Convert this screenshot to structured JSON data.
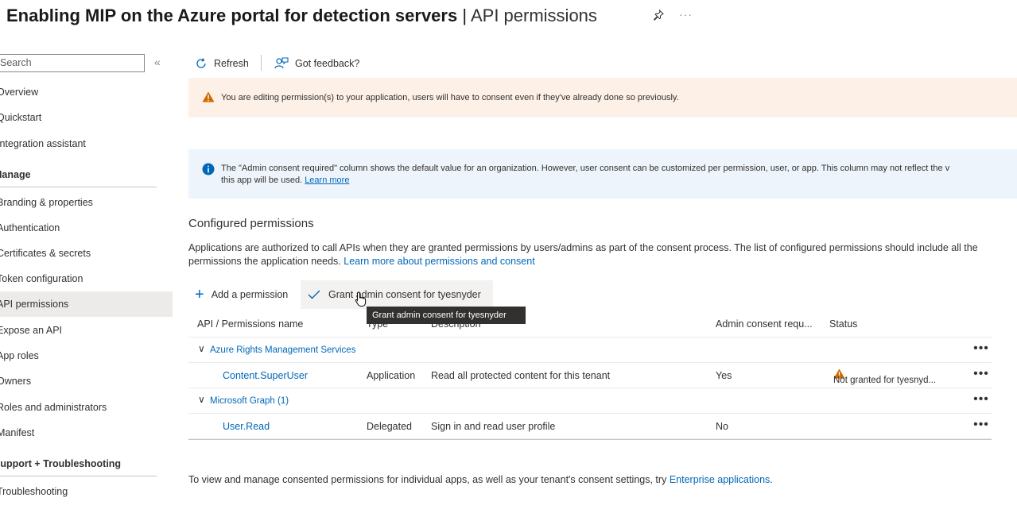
{
  "header": {
    "title": "Enabling MIP on the Azure portal for detection servers",
    "separator": "|",
    "subtitle": "API permissions",
    "more": "···"
  },
  "sidebar": {
    "search_value": "Search",
    "collapse": "«",
    "items": [
      {
        "label": "Overview"
      },
      {
        "label": "Quickstart"
      },
      {
        "label": "Integration assistant"
      }
    ],
    "manage_group": "Manage",
    "manage_items": [
      {
        "label": "Branding & properties"
      },
      {
        "label": "Authentication"
      },
      {
        "label": "Certificates & secrets"
      },
      {
        "label": "Token configuration"
      },
      {
        "label": "API permissions",
        "active": true
      },
      {
        "label": "Expose an API"
      },
      {
        "label": "App roles"
      },
      {
        "label": "Owners"
      },
      {
        "label": "Roles and administrators"
      },
      {
        "label": "Manifest"
      }
    ],
    "support_group": "Support + Troubleshooting",
    "support_items": [
      {
        "label": "Troubleshooting"
      }
    ]
  },
  "toolbar": {
    "refresh": "Refresh",
    "feedback": "Got feedback?"
  },
  "warning": {
    "text": "You are editing permission(s) to your application, users will have to consent even if they've already done so previously."
  },
  "info": {
    "line1": "The \"Admin consent required\" column shows the default value for an organization. However, user consent can be customized per permission, user, or app. This column may not reflect the v",
    "line2": "this app will be used.",
    "learn_more": "Learn more"
  },
  "configured": {
    "title": "Configured permissions",
    "desc": "Applications are authorized to call APIs when they are granted permissions by users/admins as part of the consent process. The list of configured permissions should include all the permissions the application needs.",
    "desc_link": "Learn more about permissions and consent"
  },
  "actions": {
    "add": "Add a permission",
    "grant": "Grant admin consent for tyesnyder",
    "tooltip": "Grant admin consent for tyesnyder"
  },
  "table": {
    "headers": {
      "name": "API / Permissions name",
      "type": "Type",
      "description": "Description",
      "admin": "Admin consent requ...",
      "status": "Status"
    },
    "groups": [
      {
        "name": "Azure Rights Management Services",
        "rows": [
          {
            "name": "Content.SuperUser",
            "type": "Application",
            "description": "Read all protected content for this tenant",
            "admin": "Yes",
            "status": "Not granted for tyesnyd..."
          }
        ]
      },
      {
        "name": "Microsoft Graph (1)",
        "rows": [
          {
            "name": "User.Read",
            "type": "Delegated",
            "description": "Sign in and read user profile",
            "admin": "No",
            "status": ""
          }
        ]
      }
    ],
    "dots": "•••"
  },
  "footer": {
    "text": "To view and manage consented permissions for individual apps, as well as your tenant's consent settings, try",
    "link": "Enterprise applications",
    "end": "."
  },
  "colors": {
    "accent": "#0067b8",
    "warning": "#c75c00",
    "info": "#0067b8",
    "active_bg": "#edebe9"
  }
}
